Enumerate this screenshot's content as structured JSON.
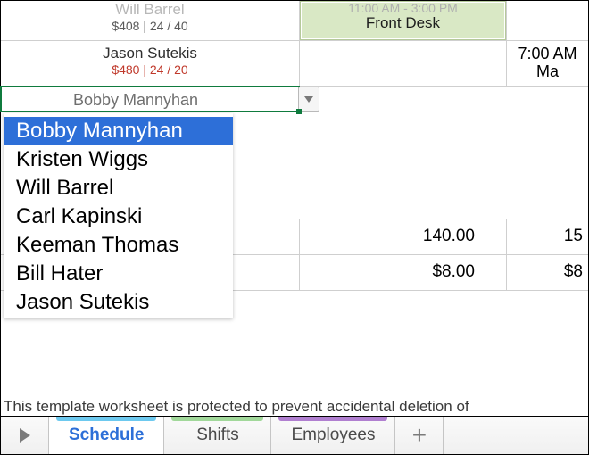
{
  "rows": [
    {
      "name": "Will Barrel",
      "sub": "$408  |  24 / 40",
      "over": false,
      "shift_time": "11:00 AM - 3:00 PM",
      "shift_role": "Front Desk",
      "right_time": "",
      "right_role": ""
    },
    {
      "name": "Jason Sutekis",
      "sub": "$480  |  24 / 20",
      "over": true,
      "right_time": "7:00 AM",
      "right_role": "Ma"
    }
  ],
  "active_cell": {
    "value": "Bobby Mannyhan"
  },
  "dropdown": {
    "selected_index": 0,
    "items": [
      "Bobby Mannyhan",
      "Kristen Wiggs",
      "Will Barrel",
      "Carl Kapinski",
      "Keeman Thomas",
      "Bill Hater",
      "Jason Sutekis"
    ]
  },
  "summary": [
    {
      "mid": "140.00",
      "right": "15"
    },
    {
      "mid": "$8.00",
      "right": "$8"
    }
  ],
  "note": "This template worksheet is protected to prevent accidental deletion of",
  "tabs": {
    "items": [
      {
        "label": "Schedule",
        "color": "#6dc9ef",
        "active": true
      },
      {
        "label": "Shifts",
        "color": "#a1d89a",
        "active": false
      },
      {
        "label": "Employees",
        "color": "#b07fd0",
        "active": false
      }
    ],
    "add": "+"
  }
}
